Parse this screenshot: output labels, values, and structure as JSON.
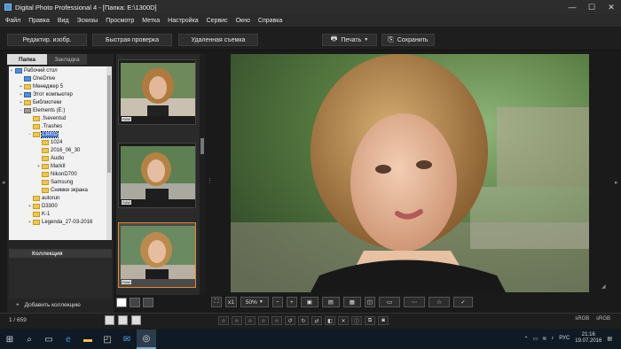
{
  "window": {
    "title": "Digital Photo Professional 4 - [Папка: E:\\1300D]",
    "minimize": "—",
    "maximize": "☐",
    "close": "✕"
  },
  "menu": [
    "Файл",
    "Правка",
    "Вид",
    "Эскизы",
    "Просмотр",
    "Метка",
    "Настройка",
    "Сервис",
    "Окно",
    "Справка"
  ],
  "toolbar": {
    "edit_image": "Редактир. изобр.",
    "quick_check": "Быстрая проверка",
    "remote_shooting": "Удаленная съемка",
    "print": "Печать",
    "save": "Сохранить"
  },
  "left_panel": {
    "tabs": [
      "Папка",
      "Закладка"
    ],
    "tree": [
      {
        "label": "Рабочий стол",
        "indent": 0,
        "icon": "blue",
        "exp": "▪"
      },
      {
        "label": "OneDrive",
        "indent": 1,
        "icon": "blue",
        "exp": ""
      },
      {
        "label": "Менеджер 5",
        "indent": 1,
        "icon": "yellow",
        "exp": "+"
      },
      {
        "label": "Этот компьютер",
        "indent": 1,
        "icon": "blue",
        "exp": "+"
      },
      {
        "label": "Библиотеки",
        "indent": 1,
        "icon": "yellow",
        "exp": "+"
      },
      {
        "label": "Elements (E:)",
        "indent": 1,
        "icon": "drive",
        "exp": "−"
      },
      {
        "label": ".fseventsd",
        "indent": 2,
        "icon": "yellow",
        "exp": ""
      },
      {
        "label": ".Trashes",
        "indent": 2,
        "icon": "yellow",
        "exp": ""
      },
      {
        "label": "1300D",
        "indent": 2,
        "icon": "yellow",
        "exp": "−",
        "selected": true
      },
      {
        "label": "1024",
        "indent": 3,
        "icon": "yellow",
        "exp": ""
      },
      {
        "label": "2016_06_30",
        "indent": 3,
        "icon": "yellow",
        "exp": ""
      },
      {
        "label": "Audio",
        "indent": 3,
        "icon": "yellow",
        "exp": ""
      },
      {
        "label": "MarkII",
        "indent": 3,
        "icon": "yellow",
        "exp": "+"
      },
      {
        "label": "NikonD700",
        "indent": 3,
        "icon": "yellow",
        "exp": ""
      },
      {
        "label": "Samsung",
        "indent": 3,
        "icon": "yellow",
        "exp": ""
      },
      {
        "label": "Снимки экрана",
        "indent": 3,
        "icon": "yellow",
        "exp": ""
      },
      {
        "label": "autorun",
        "indent": 2,
        "icon": "yellow",
        "exp": ""
      },
      {
        "label": "D3300",
        "indent": 2,
        "icon": "yellow",
        "exp": "+"
      },
      {
        "label": "K-1",
        "indent": 2,
        "icon": "yellow",
        "exp": ""
      },
      {
        "label": "Legenda_27-03-2016",
        "indent": 2,
        "icon": "yellow",
        "exp": "+"
      }
    ],
    "collection_header": "Коллекция",
    "add_collection": "Добавить коллекцию"
  },
  "thumbnails": {
    "badge": "RAW"
  },
  "viewer_bar": {
    "fit": "⛶",
    "zoom_1x": "x1",
    "zoom_level": "50%",
    "zoom_out": "−",
    "zoom_in": "+"
  },
  "status": {
    "count": "1 / 659",
    "color_space_1": "sRGB",
    "color_space_2": "sRGB"
  },
  "taskbar": {
    "lang": "РУС",
    "time": "21:16",
    "date": "19.07.2016"
  },
  "colors": {
    "accent_selection": "#e08a2c",
    "tree_selection": "#3b6fd0"
  }
}
